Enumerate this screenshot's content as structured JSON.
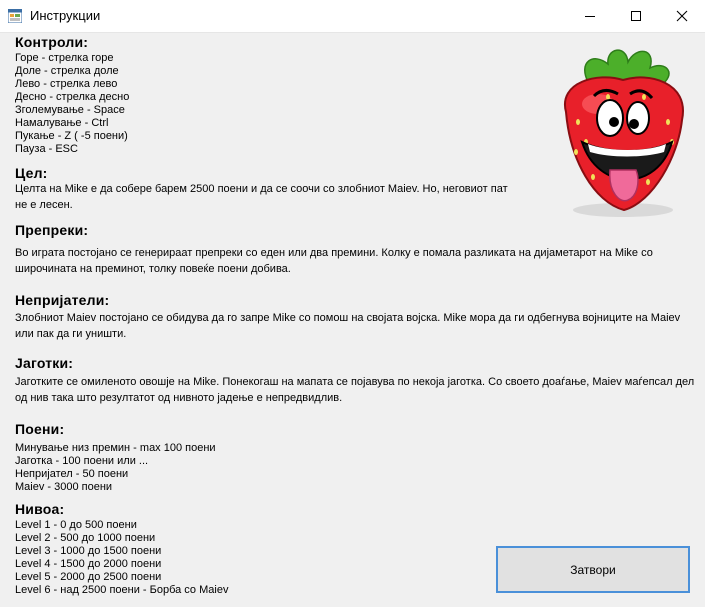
{
  "window": {
    "title": "Инструкции"
  },
  "sections": {
    "controls": {
      "heading": "Контроли:",
      "lines": [
        "Горе - стрелка горе",
        "Доле - стрелка доле",
        "Лево - стрелка лево",
        "Десно - стрелка десно",
        "Зголемување - Space",
        "Намалување - Ctrl",
        "Пукање - Z ( -5 поени)",
        "Пауза - ESC"
      ]
    },
    "goal": {
      "heading": "Цел:",
      "text": "Целта на Mike е да собере барем 2500 поени и да се соочи со злобниот Maiev. Но, неговиот пат не е лесен."
    },
    "obstacles": {
      "heading": "Препреки:",
      "text": "Во играта постојано се генерираат препреки со еден или два премини. Колку е помала разликата на дијаметарот на Mike со широчината на преминот, толку повеќе поени добива."
    },
    "enemies": {
      "heading": "Непријатели:",
      "text": "Злобниот Maiev постојано се обидува да го запре Mike со помош на својата војска. Mike мора да ги одбегнува војниците на Maiev или пак да ги уништи."
    },
    "strawberries": {
      "heading": "Јаготки:",
      "text": "Јаготките се омиленото овошје на Mike. Понекогаш на мапата се појавува по некоја јаготка. Со своето  доаѓање, Maiev мaѓепсал дел од нив така што резултатот од нивното јадење е непредвидлив."
    },
    "points": {
      "heading": "Поени:",
      "lines": [
        "Минување низ премин - max 100 поени",
        "Јаготка - 100 поени или ...",
        "Непријател - 50 поени",
        "Maiev - 3000 поени"
      ]
    },
    "levels": {
      "heading": "Нивоа:",
      "lines": [
        "Level 1 - 0 до 500 поени",
        "Level 2 - 500 до 1000 поени",
        "Level 3 - 1000 до 1500 поени",
        "Level 4 - 1500 до 2000 поени",
        "Level 5 - 2000 до 2500 поени",
        "Level 6 - над 2500 поени - Борба со Maiev"
      ]
    }
  },
  "buttons": {
    "close_label": "Затвори"
  },
  "icons": {
    "app": "app-icon",
    "minimize": "minimize-icon",
    "maximize": "maximize-icon",
    "close": "close-icon",
    "picture": "strawberry-mascot"
  },
  "colors": {
    "window_bg": "#f0f0f0",
    "titlebar_bg": "#ffffff",
    "button_border": "#4a90d9",
    "strawberry_red": "#e8202a",
    "leaf_green": "#4caf2a"
  }
}
